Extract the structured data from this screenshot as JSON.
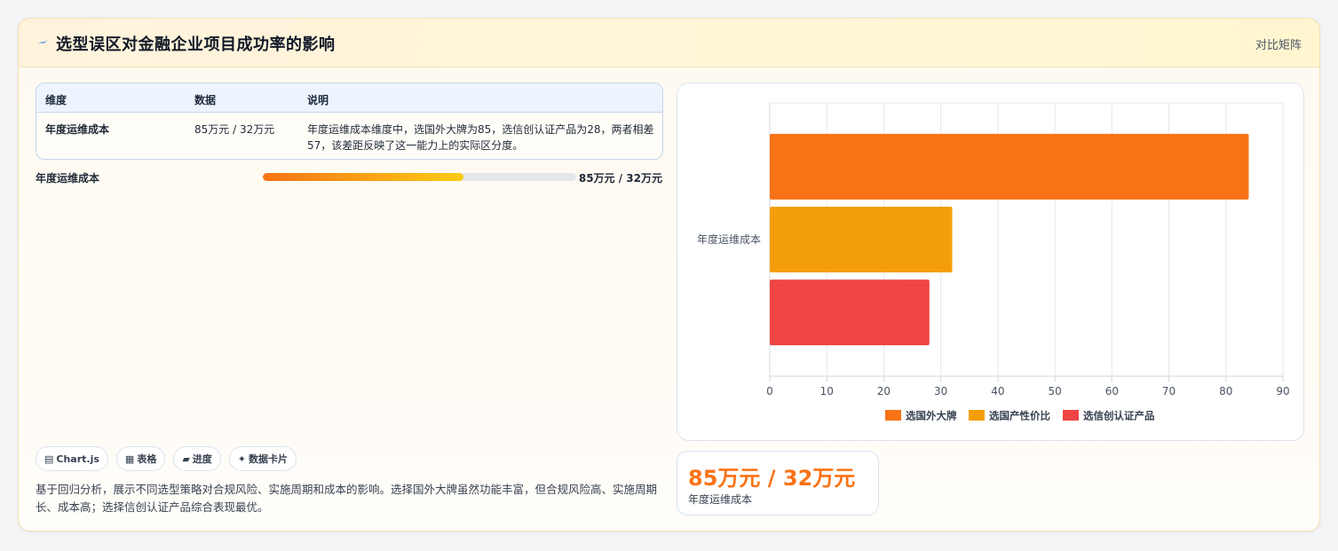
{
  "header": {
    "title": "选型误区对金融企业项目成功率的影响",
    "action_label": "对比矩阵",
    "icon": "lightning-icon",
    "accent": "#2563eb"
  },
  "table": {
    "columns": [
      "维度",
      "数据",
      "说明"
    ],
    "rows": [
      {
        "dimension": "年度运维成本",
        "data": "85万元 / 32万元",
        "description": "年度运维成本维度中，选国外大牌为85，选信创认证产品为28，两者相差57，该差距反映了这一能力上的实际区分度。"
      }
    ]
  },
  "progress": {
    "label": "年度运维成本",
    "value_text": "85万元 / 32万元",
    "fraction": 0.64
  },
  "chips": [
    {
      "icon": "chart-icon",
      "glyph": "▤",
      "label": "Chart.js"
    },
    {
      "icon": "table-icon",
      "glyph": "▦",
      "label": "表格"
    },
    {
      "icon": "progress-icon",
      "glyph": "▰",
      "label": "进度"
    },
    {
      "icon": "sparkle-icon",
      "glyph": "✦",
      "label": "数据卡片"
    }
  ],
  "summary": "基于回归分析，展示不同选型策略对合规风险、实施周期和成本的影响。选择国外大牌虽然功能丰富，但合规风险高、实施周期长、成本高；选择信创认证产品综合表现最优。",
  "stat": {
    "value": "85万元 / 32万元",
    "label": "年度运维成本"
  },
  "chart_data": {
    "type": "bar",
    "orientation": "horizontal",
    "categories": [
      "年度运维成本"
    ],
    "series": [
      {
        "name": "选国外大牌",
        "values": [
          84
        ],
        "color": "#f97316"
      },
      {
        "name": "选国产性价比",
        "values": [
          32
        ],
        "color": "#f59e0b"
      },
      {
        "name": "选信创认证产品",
        "values": [
          28
        ],
        "color": "#ef4444"
      }
    ],
    "xlim": [
      0,
      90
    ],
    "xticks": [
      0,
      10,
      20,
      30,
      40,
      50,
      60,
      70,
      80,
      90
    ],
    "grid": true,
    "legend_position": "bottom"
  }
}
